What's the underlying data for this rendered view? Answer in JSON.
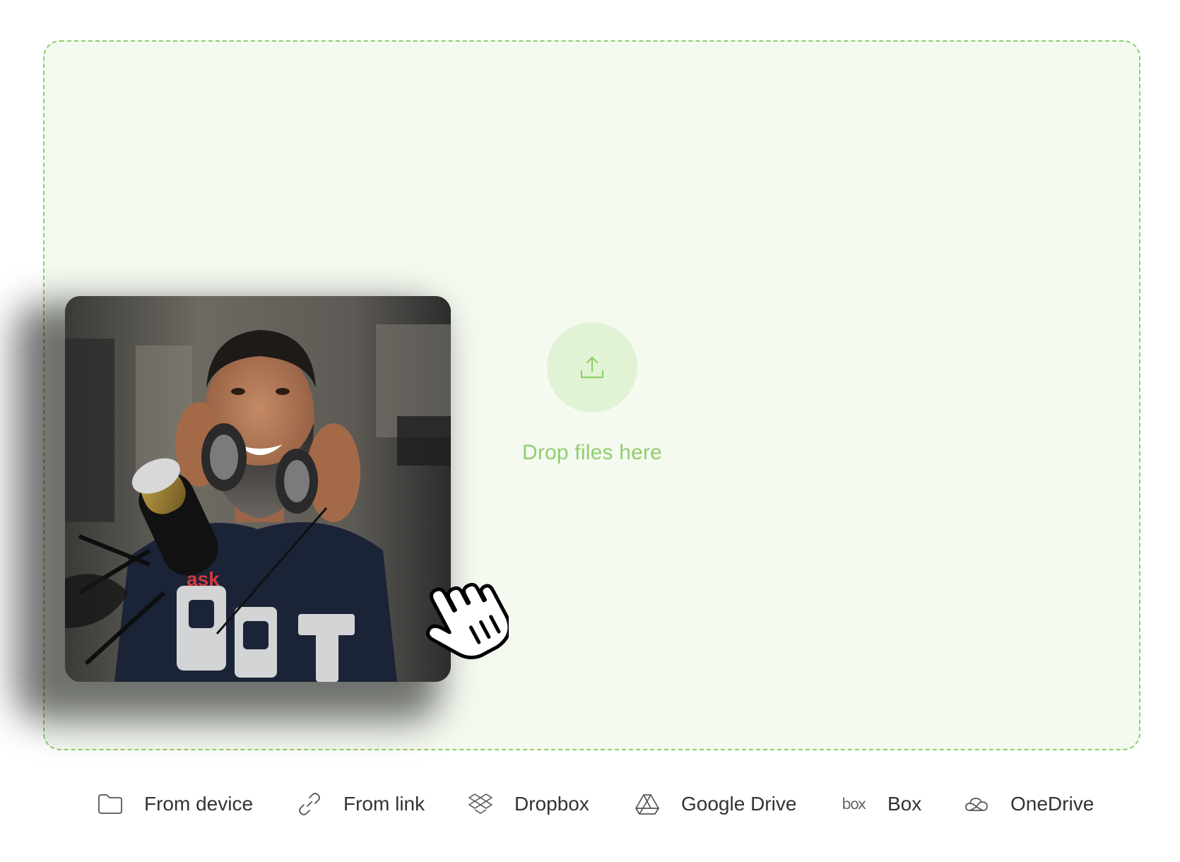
{
  "dropzone": {
    "label": "Drop files here",
    "upload_icon": "upload-icon",
    "accent_color": "#8fce6c",
    "background_color": "#f5faf1"
  },
  "dragged_file": {
    "type": "photo",
    "description_icon": "photo-thumbnail",
    "cursor_icon": "hand-grab-cursor"
  },
  "sources": [
    {
      "label": "From device",
      "icon": "folder-icon"
    },
    {
      "label": "From link",
      "icon": "link-icon"
    },
    {
      "label": "Dropbox",
      "icon": "dropbox-icon"
    },
    {
      "label": "Google Drive",
      "icon": "google-drive-icon"
    },
    {
      "label": "Box",
      "icon": "box-icon",
      "icon_text": "box"
    },
    {
      "label": "OneDrive",
      "icon": "onedrive-icon"
    }
  ]
}
